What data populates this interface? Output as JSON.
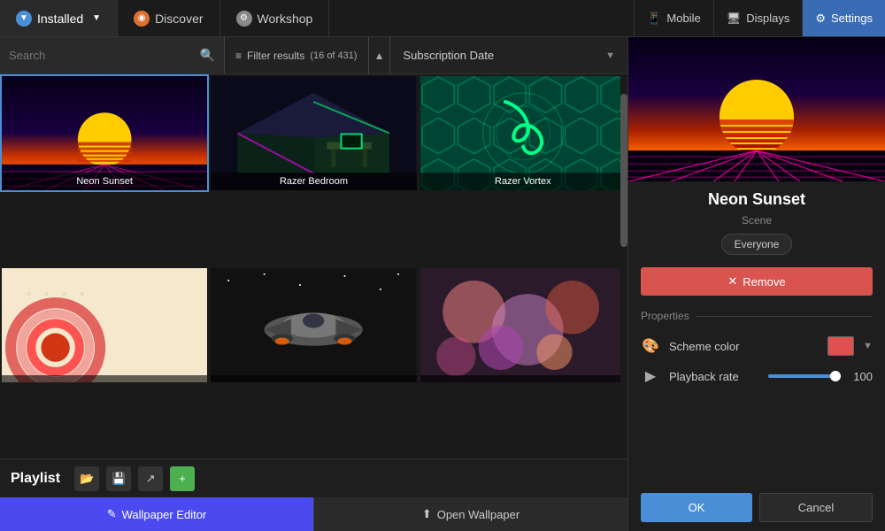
{
  "nav": {
    "installed_label": "Installed",
    "discover_label": "Discover",
    "workshop_label": "Workshop",
    "mobile_label": "Mobile",
    "displays_label": "Displays",
    "settings_label": "Settings"
  },
  "filter_bar": {
    "search_placeholder": "Search",
    "filter_label": "Filter results",
    "filter_count": "(16 of 431)",
    "sort_label": "Subscription Date"
  },
  "wallpapers": [
    {
      "id": 1,
      "name": "Neon Sunset",
      "type": "neon-sunset",
      "selected": true
    },
    {
      "id": 2,
      "name": "Razer Bedroom",
      "type": "razer-bedroom",
      "selected": false
    },
    {
      "id": 3,
      "name": "Razer Vortex",
      "type": "razer-vortex",
      "selected": false
    },
    {
      "id": 4,
      "name": "",
      "type": "circles",
      "selected": false
    },
    {
      "id": 5,
      "name": "",
      "type": "spaceship",
      "selected": false
    },
    {
      "id": 6,
      "name": "",
      "type": "blur",
      "selected": false
    }
  ],
  "playlist": {
    "label": "Playlist",
    "open_icon": "folder-icon",
    "save_icon": "save-icon",
    "share_icon": "share-icon",
    "add_icon": "plus-icon"
  },
  "bottom_bar": {
    "wallpaper_editor_label": "Wallpaper Editor",
    "open_wallpaper_label": "Open Wallpaper"
  },
  "right_panel": {
    "title": "Neon Sunset",
    "type": "Scene",
    "rating": "Everyone",
    "remove_label": "✕ Remove",
    "properties_label": "Properties",
    "scheme_color_label": "Scheme color",
    "scheme_color_value": "#e05050",
    "playback_rate_label": "Playback rate",
    "playback_rate_value": "100",
    "playback_rate_percent": 100
  },
  "dialog_buttons": {
    "ok_label": "OK",
    "cancel_label": "Cancel"
  },
  "colors": {
    "accent_blue": "#4a8fd5",
    "accent_red": "#d9534f",
    "accent_purple": "#4a4af0",
    "bg_dark": "#1a1a1a",
    "bg_medium": "#222222",
    "border_color": "#333333"
  }
}
